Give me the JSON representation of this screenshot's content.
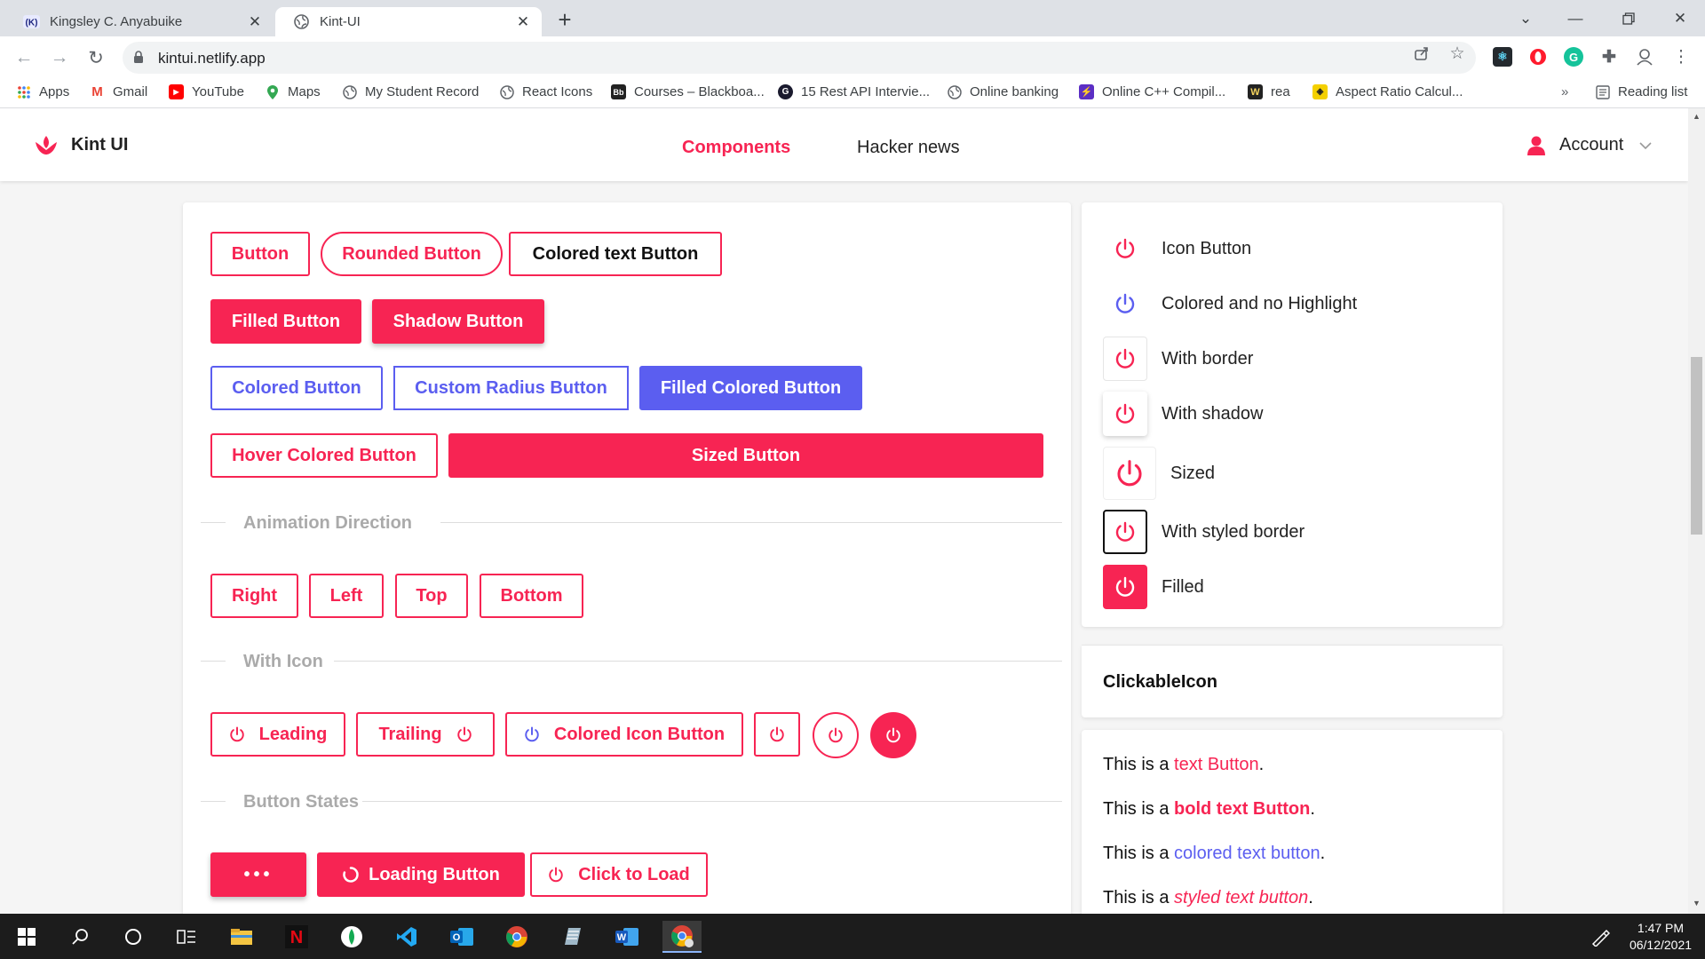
{
  "browser": {
    "tabs": [
      {
        "title": "Kingsley C. Anyabuike",
        "favicon": "k-badge-icon",
        "active": false
      },
      {
        "title": "Kint-UI",
        "favicon": "globe-icon",
        "active": true
      }
    ],
    "url": "kintui.netlify.app",
    "bookmarks": [
      "Apps",
      "Gmail",
      "YouTube",
      "Maps",
      "My Student Record",
      "React Icons",
      "Courses – Blackboa...",
      "15 Rest API Intervie...",
      "Online banking",
      "Online C++ Compil...",
      "rea",
      "Aspect Ratio Calcul..."
    ],
    "bookmarks_overflow": "»",
    "reading_list": "Reading list"
  },
  "app": {
    "brand": "Kint UI",
    "nav": [
      "Components",
      "Hacker news"
    ],
    "account": "Account",
    "accent": "#f72453",
    "secondary": "#5b5ef0"
  },
  "buttons": {
    "row1": [
      "Button",
      "Rounded Button",
      "Colored text Button"
    ],
    "row2": [
      "Filled Button",
      "Shadow Button"
    ],
    "row3": [
      "Colored Button",
      "Custom Radius Button",
      "Filled Colored Button"
    ],
    "row4": [
      "Hover Colored Button",
      "Sized Button"
    ],
    "animation_heading": "Animation Direction",
    "animation": [
      "Right",
      "Left",
      "Top",
      "Bottom"
    ],
    "icon_heading": "With Icon",
    "icon_buttons": [
      "Leading",
      "Trailing",
      "Colored Icon Button"
    ],
    "states_heading": "Button States",
    "states": [
      "•••",
      "Loading Button",
      "Click to Load"
    ]
  },
  "icon_buttons_panel": {
    "items": [
      "Icon Button",
      "Colored and no Highlight",
      "With border",
      "With shadow",
      "Sized",
      "With styled border",
      "Filled"
    ],
    "clickable_heading": "ClickableIcon"
  },
  "text_buttons": {
    "prefix": "This is a",
    "items": [
      {
        "link": "text Button",
        "suffix": "."
      },
      {
        "link": "bold text Button",
        "suffix": "."
      },
      {
        "link": "colored text button",
        "suffix": "."
      },
      {
        "link": "styled text button",
        "suffix": "."
      }
    ]
  },
  "taskbar": {
    "time": "1:47 PM",
    "date": "06/12/2021"
  }
}
